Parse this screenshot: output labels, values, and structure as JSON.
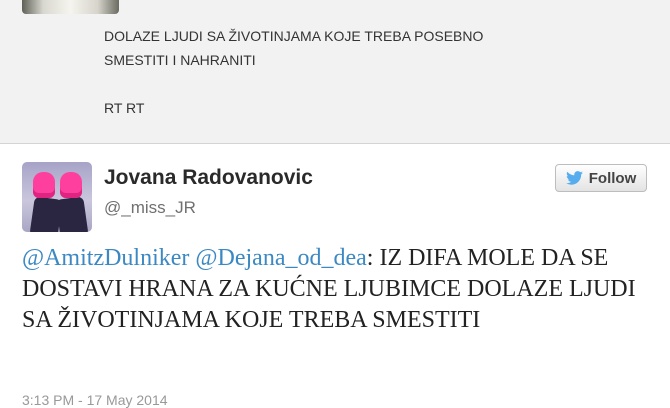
{
  "previous_tweet": {
    "text": "DOLAZE LJUDI SA ŽIVOTINJAMA KOJE TREBA POSEBNO\nSMESTITI I NAHRANITI\n\nRT RT"
  },
  "tweet": {
    "author_name": "Jovana Radovanovic",
    "author_handle": "@_miss_JR",
    "follow_label": "Follow",
    "mention_1": "@AmitzDulniker",
    "mention_2": "@Dejana_od_dea",
    "body": ": IZ DIFA MOLE DA SE DOSTAVI HRANA ZA KUĆNE LJUBIMCE DOLAZE LJUDI SA ŽIVOTINJAMA KOJE TREBA SMESTITI",
    "timestamp": "3:13 PM - 17 May 2014"
  },
  "colors": {
    "mention": "#3b88c3",
    "twitter_bird": "#55acee"
  }
}
